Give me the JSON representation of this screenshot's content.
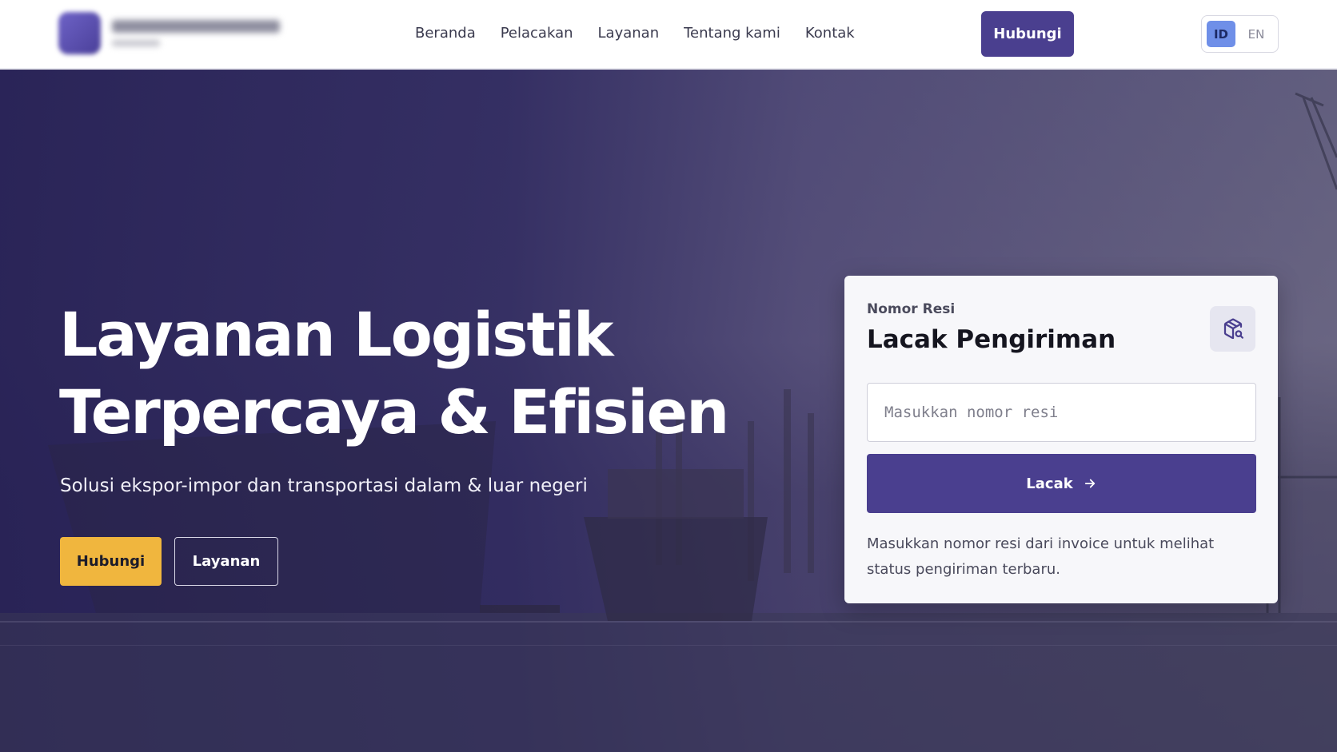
{
  "brand": {
    "name": "",
    "tagline": ""
  },
  "nav": {
    "items": [
      {
        "label": "Beranda"
      },
      {
        "label": "Pelacakan"
      },
      {
        "label": "Layanan"
      },
      {
        "label": "Tentang kami"
      },
      {
        "label": "Kontak"
      }
    ],
    "cta_label": "Hubungi"
  },
  "language": {
    "options": [
      "ID",
      "EN"
    ],
    "selected": "ID"
  },
  "hero": {
    "title_line1": "Layanan Logistik",
    "title_line2": "Terpercaya & Efisien",
    "subtitle": "Solusi ekspor-impor dan transportasi dalam & luar negeri",
    "primary_button": "Hubungi",
    "secondary_button": "Layanan"
  },
  "tracking": {
    "eyebrow": "Nomor Resi",
    "title": "Lacak Pengiriman",
    "input_value": "",
    "input_placeholder": "Masukkan nomor resi",
    "button_label": "Lacak",
    "help_text": "Masukkan nomor resi dari invoice untuk melihat status pengiriman terbaru.",
    "icon": "package-search-icon"
  },
  "colors": {
    "primary": "#4a3f8f",
    "accent": "#f0b63e",
    "lang_active": "#6f8fe8"
  }
}
